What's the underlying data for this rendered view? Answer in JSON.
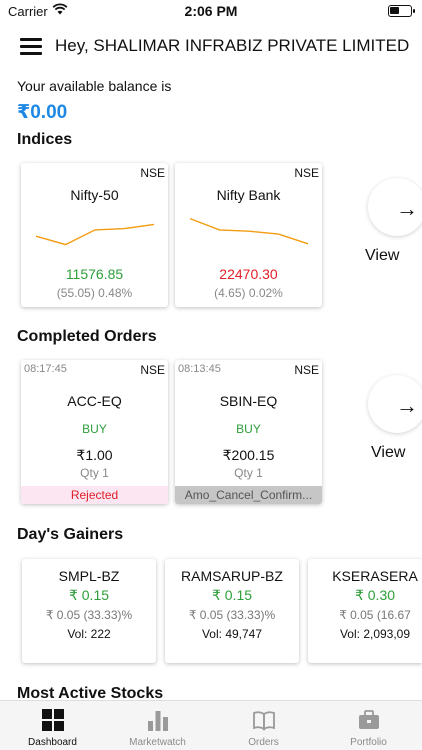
{
  "status_bar": {
    "carrier": "Carrier",
    "time": "2:06 PM"
  },
  "header": {
    "greeting": "Hey, SHALIMAR INFRABIZ PRIVATE LIMITED"
  },
  "balance": {
    "label": "Your available balance is",
    "value": "₹0.00"
  },
  "indices": {
    "title": "Indices",
    "view_label": "View",
    "items": [
      {
        "exchange": "NSE",
        "name": "Nifty-50",
        "value": "11576.85",
        "change": "(55.05) 0.48%",
        "trend": "up",
        "sparkline": [
          0.4,
          0.2,
          0.55,
          0.58,
          0.68
        ]
      },
      {
        "exchange": "NSE",
        "name": "Nifty Bank",
        "value": "22470.30",
        "change": "(4.65) 0.02%",
        "trend": "down",
        "sparkline": [
          0.82,
          0.55,
          0.52,
          0.45,
          0.22
        ]
      }
    ]
  },
  "completed_orders": {
    "title": "Completed Orders",
    "view_label": "View",
    "items": [
      {
        "time": "08:17:45",
        "exchange": "NSE",
        "symbol": "ACC-EQ",
        "side": "BUY",
        "price": "₹1.00",
        "qty": "Qty  1",
        "status": "Rejected",
        "status_type": "rejected"
      },
      {
        "time": "08:13:45",
        "exchange": "NSE",
        "symbol": "SBIN-EQ",
        "side": "BUY",
        "price": "₹200.15",
        "qty": "Qty  1",
        "status": "Amo_Cancel_Confirm...",
        "status_type": "cancel"
      }
    ]
  },
  "gainers": {
    "title": "Day's Gainers",
    "items": [
      {
        "symbol": "SMPL-BZ",
        "price": "₹ 0.15",
        "change": "₹ 0.05  (33.33)%",
        "volume": "Vol: 222"
      },
      {
        "symbol": "RAMSARUP-BZ",
        "price": "₹ 0.15",
        "change": "₹ 0.05  (33.33)%",
        "volume": "Vol: 49,747"
      },
      {
        "symbol": "KSERASERA",
        "price": "₹ 0.30",
        "change": "₹ 0.05  (16.67",
        "volume": "Vol: 2,093,09"
      }
    ]
  },
  "most_active": {
    "title": "Most Active Stocks"
  },
  "tabs": [
    {
      "label": "Dashboard",
      "icon": "dashboard-icon",
      "active": true
    },
    {
      "label": "Marketwatch",
      "icon": "bar-chart-icon",
      "active": false
    },
    {
      "label": "Orders",
      "icon": "book-icon",
      "active": false
    },
    {
      "label": "Portfolio",
      "icon": "briefcase-icon",
      "active": false
    }
  ],
  "colors": {
    "accent": "#1e88e5",
    "up": "#2e9e3a",
    "down": "#e0202a",
    "sparkline": "#f39c12"
  }
}
